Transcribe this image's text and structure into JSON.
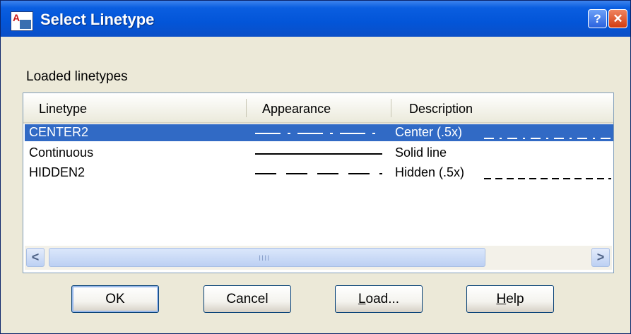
{
  "window": {
    "title": "Select Linetype",
    "help_glyph": "?",
    "close_glyph": "✕",
    "app_icon_glyph": "A"
  },
  "group_label": "Loaded linetypes",
  "columns": [
    "Linetype",
    "Appearance",
    "Description"
  ],
  "linetypes": [
    {
      "name": "CENTER2",
      "description": "Center (.5x)",
      "pattern": "center",
      "selected": true
    },
    {
      "name": "Continuous",
      "description": "Solid line",
      "pattern": "continuous",
      "selected": false
    },
    {
      "name": "HIDDEN2",
      "description": "Hidden (.5x)",
      "pattern": "hidden",
      "selected": false
    }
  ],
  "scrollbar": {
    "left_arrow": "<",
    "right_arrow": ">",
    "grip": "IIII"
  },
  "buttons": {
    "ok": "OK",
    "cancel": "Cancel",
    "load": "Load...",
    "help": "Help"
  },
  "colors": {
    "selection": "#316ac5",
    "titlebar": "#0355d8"
  }
}
